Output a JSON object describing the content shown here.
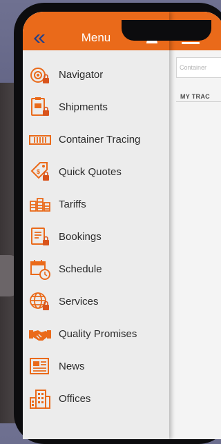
{
  "drawer": {
    "title": "Menu",
    "logo_icon": "chevron-logo-icon",
    "user_icon": "user-icon",
    "items": [
      {
        "label": "Navigator",
        "icon": "navigator-icon"
      },
      {
        "label": "Shipments",
        "icon": "shipments-icon"
      },
      {
        "label": "Container Tracing",
        "icon": "container-icon"
      },
      {
        "label": "Quick Quotes",
        "icon": "quote-tag-icon"
      },
      {
        "label": "Tariffs",
        "icon": "tariffs-icon"
      },
      {
        "label": "Bookings",
        "icon": "bookings-icon"
      },
      {
        "label": "Schedule",
        "icon": "schedule-icon"
      },
      {
        "label": "Services",
        "icon": "globe-services-icon"
      },
      {
        "label": "Quality Promises",
        "icon": "handshake-icon"
      },
      {
        "label": "News",
        "icon": "newspaper-icon"
      },
      {
        "label": "Offices",
        "icon": "building-icon"
      }
    ]
  },
  "main": {
    "menu_icon": "hamburger-icon",
    "search_placeholder": "Container",
    "section_label": "MY TRAC"
  },
  "colors": {
    "accent": "#ea6a1a",
    "drawer_bg": "#ececec",
    "text": "#2c2c2c",
    "lock": "#d9541c"
  }
}
